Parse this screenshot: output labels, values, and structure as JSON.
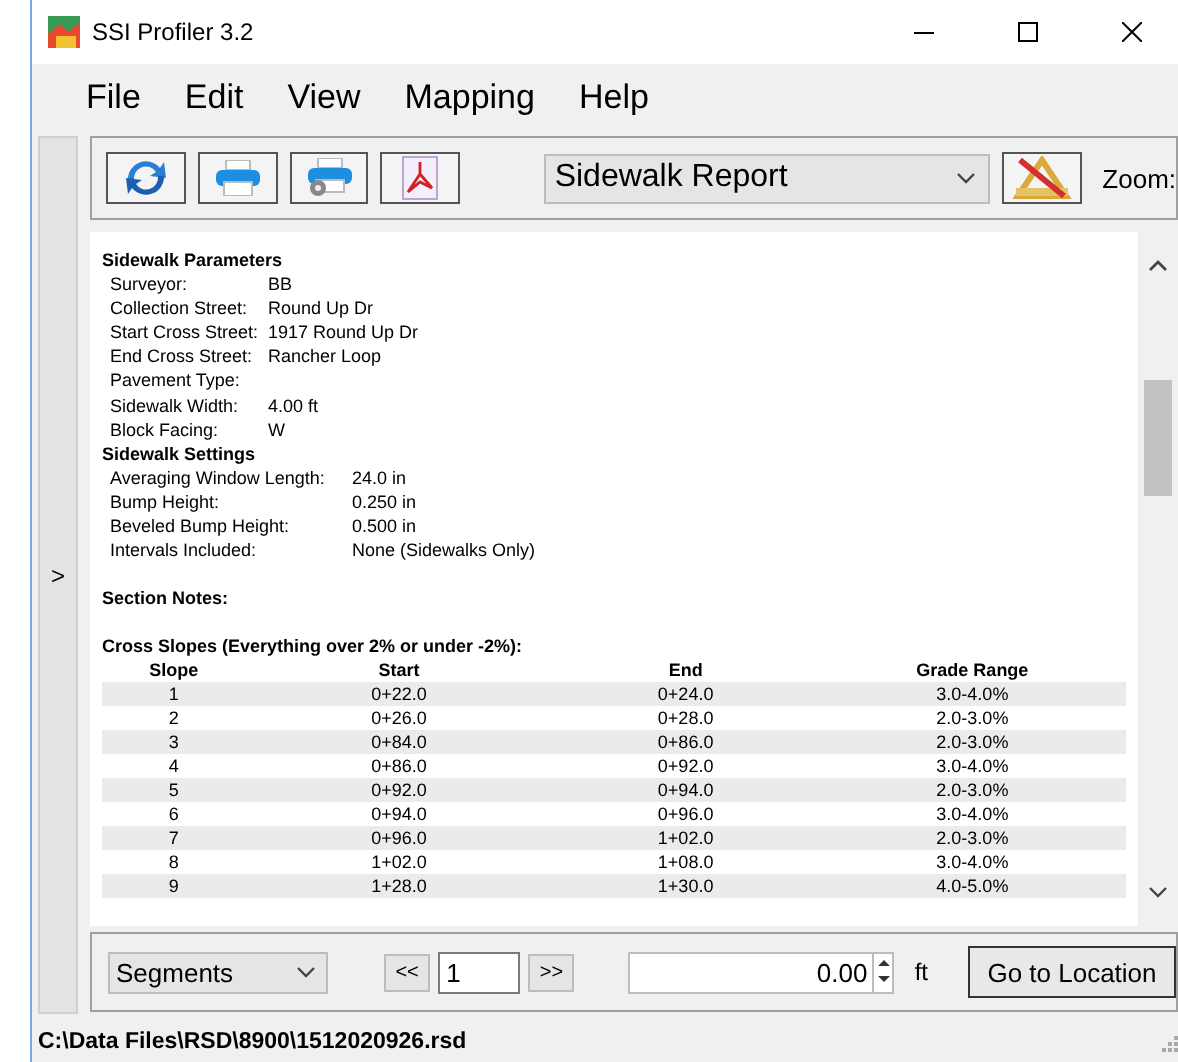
{
  "window": {
    "title": "SSI Profiler 3.2"
  },
  "menu": [
    "File",
    "Edit",
    "View",
    "Mapping",
    "Help"
  ],
  "side_panel": {
    "toggle": ">"
  },
  "toolbar": {
    "report_select": "Sidewalk Report",
    "zoom_label": "Zoom:"
  },
  "report": {
    "parameters": {
      "title": "Sidewalk Parameters",
      "fields": [
        {
          "label": "Surveyor:",
          "value": "BB"
        },
        {
          "label": "Collection Street:",
          "value": "Round Up Dr"
        },
        {
          "label": "Start Cross Street:",
          "value": "1917 Round Up Dr"
        },
        {
          "label": "End Cross Street:",
          "value": "Rancher Loop"
        },
        {
          "label": "Pavement Type:"
        },
        {
          "label": "Sidewalk Width:",
          "value": "4.00 ft"
        },
        {
          "label": "Block Facing:",
          "value": "W"
        }
      ]
    },
    "settings": {
      "title": "Sidewalk Settings",
      "fields": [
        {
          "label": "Averaging Window Length:",
          "value": "24.0 in"
        },
        {
          "label": "Bump Height:",
          "value": "0.250 in"
        },
        {
          "label": "Beveled Bump Height:",
          "value": "0.500 in"
        },
        {
          "label": "Intervals Included:",
          "value": "None (Sidewalks Only)"
        }
      ]
    },
    "section_notes": "Section Notes:",
    "cross_slopes": {
      "title": "Cross Slopes (Everything over 2% or under -2%):",
      "columns": [
        "Slope",
        "Start",
        "End",
        "Grade Range"
      ],
      "rows": [
        [
          "1",
          "0+22.0",
          "0+24.0",
          "3.0-4.0%"
        ],
        [
          "2",
          "0+26.0",
          "0+28.0",
          "2.0-3.0%"
        ],
        [
          "3",
          "0+84.0",
          "0+86.0",
          "2.0-3.0%"
        ],
        [
          "4",
          "0+86.0",
          "0+92.0",
          "3.0-4.0%"
        ],
        [
          "5",
          "0+92.0",
          "0+94.0",
          "2.0-3.0%"
        ],
        [
          "6",
          "0+94.0",
          "0+96.0",
          "3.0-4.0%"
        ],
        [
          "7",
          "0+96.0",
          "1+02.0",
          "2.0-3.0%"
        ],
        [
          "8",
          "1+02.0",
          "1+08.0",
          "3.0-4.0%"
        ],
        [
          "9",
          "1+28.0",
          "1+30.0",
          "4.0-5.0%"
        ]
      ]
    }
  },
  "navigation": {
    "segment_select": "Segments",
    "prev": "<<",
    "page": "1",
    "next": ">>",
    "distance": "0.00",
    "unit": "ft",
    "go_button": "Go to Location"
  },
  "status_bar": "C:\\Data Files\\RSD\\8900\\1512020926.rsd"
}
